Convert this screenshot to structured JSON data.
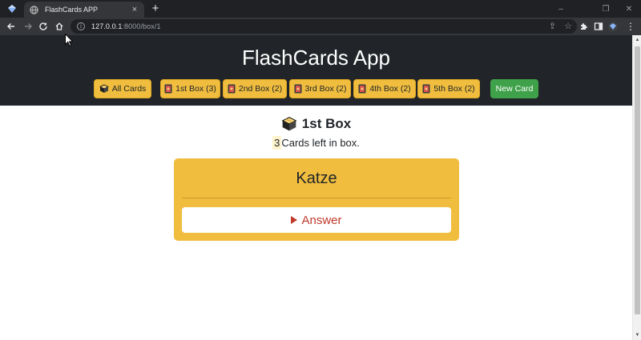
{
  "browser": {
    "tab_title": "FlashCards APP",
    "tab_close": "×",
    "new_tab": "+",
    "url_host": "127.0.0.1",
    "url_rest": ":8000/box/1",
    "window_controls": {
      "minimize": "–",
      "restore": "❐",
      "close": "✕"
    }
  },
  "header": {
    "title": "FlashCards App",
    "nav": [
      {
        "label": "All Cards",
        "icon": "box-icon"
      },
      {
        "label": "1st Box (3)",
        "icon": "card-icon"
      },
      {
        "label": "2nd Box (2)",
        "icon": "card-icon"
      },
      {
        "label": "3rd Box (2)",
        "icon": "card-icon"
      },
      {
        "label": "4th Box (2)",
        "icon": "card-icon"
      },
      {
        "label": "5th Box (2)",
        "icon": "card-icon"
      }
    ],
    "new_card": "New Card"
  },
  "box": {
    "heading": "1st Box",
    "count": "3",
    "cards_left_text": "Cards left in box."
  },
  "card": {
    "front": "Katze",
    "answer_label": "Answer"
  },
  "colors": {
    "header_bg": "#212529",
    "accent": "#f0bd3e",
    "new_card_green": "#3fa14a",
    "answer_red": "#c0392b"
  }
}
